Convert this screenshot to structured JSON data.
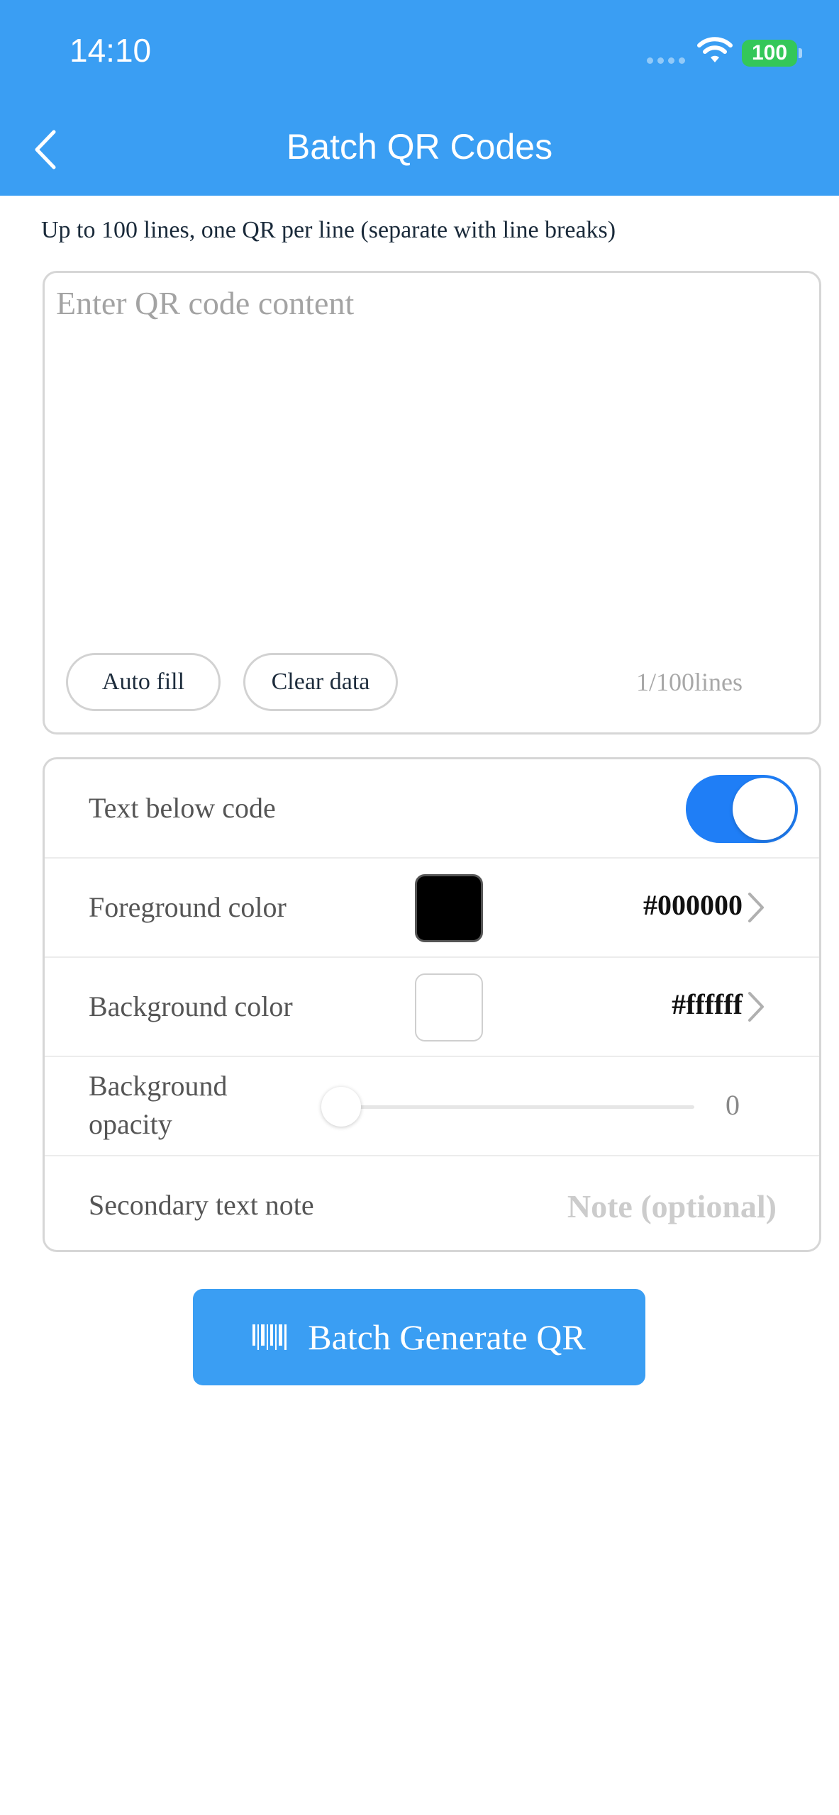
{
  "status_bar": {
    "time": "14:10",
    "battery": "100",
    "icons": [
      "signal-icon",
      "wifi-icon",
      "battery-icon"
    ]
  },
  "header": {
    "title": "Batch QR Codes",
    "back_icon": "chevron-left-icon"
  },
  "hint": "Up to 100 lines, one QR per line (separate with line breaks)",
  "editor": {
    "placeholder": "Enter QR code content",
    "value": "",
    "auto_fill_label": "Auto fill",
    "clear_label": "Clear data",
    "line_count": "1/100lines"
  },
  "settings": {
    "text_below_code": {
      "label": "Text below code",
      "enabled": true
    },
    "foreground": {
      "label": "Foreground color",
      "value": "#000000",
      "swatch": "#000000"
    },
    "background": {
      "label": "Background color",
      "value": "#ffffff",
      "swatch": "#ffffff"
    },
    "opacity": {
      "label_line1": "Background",
      "label_line2": "opacity",
      "value": "0"
    },
    "secondary_note": {
      "label": "Secondary text note",
      "placeholder": "Note (optional)"
    }
  },
  "generate": {
    "label": "Batch Generate QR",
    "icon": "barcode-icon"
  },
  "colors": {
    "header": "#3a9ef3",
    "toggle_on": "#1f7ef6",
    "battery": "#34c759"
  }
}
